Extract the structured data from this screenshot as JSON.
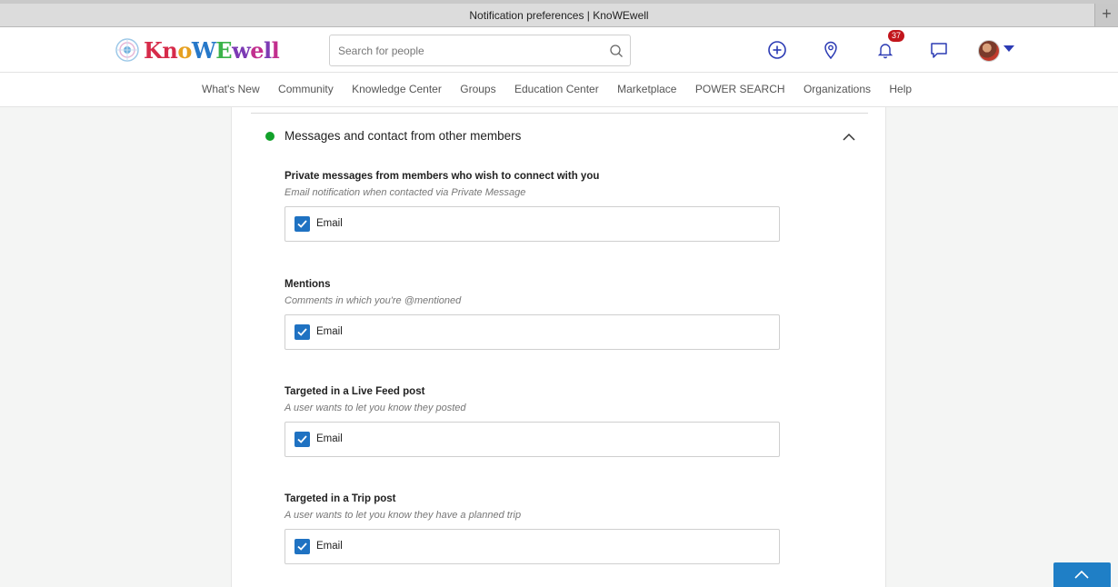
{
  "window": {
    "title": "Notification preferences | KnoWEwell",
    "new_tab": "+"
  },
  "header": {
    "logo_text": "KnoWEwell",
    "search_placeholder": "Search for people",
    "notification_count": "37",
    "icons": [
      "plus-circle-icon",
      "location-pin-icon",
      "bell-icon",
      "chat-bubble-icon",
      "search-icon"
    ]
  },
  "nav": {
    "items": [
      "What's New",
      "Community",
      "Knowledge Center",
      "Groups",
      "Education Center",
      "Marketplace",
      "POWER SEARCH",
      "Organizations",
      "Help"
    ]
  },
  "section": {
    "title": "Messages and contact from other members",
    "status_color": "#12a12a",
    "expanded": true
  },
  "prefs": [
    {
      "title": "Private messages from members who wish to connect with you",
      "desc": "Email notification when contacted via Private Message",
      "option": "Email",
      "checked": true
    },
    {
      "title": "Mentions",
      "desc": "Comments in which you're @mentioned",
      "option": "Email",
      "checked": true
    },
    {
      "title": "Targeted in a Live Feed post",
      "desc": "A user wants to let you know they posted",
      "option": "Email",
      "checked": true
    },
    {
      "title": "Targeted in a Trip post",
      "desc": "A user wants to let you know they have a planned trip",
      "option": "Email",
      "checked": true
    }
  ],
  "colors": {
    "accent": "#1f72c2",
    "badge": "#c2151c",
    "icon": "#2c3bb4"
  }
}
